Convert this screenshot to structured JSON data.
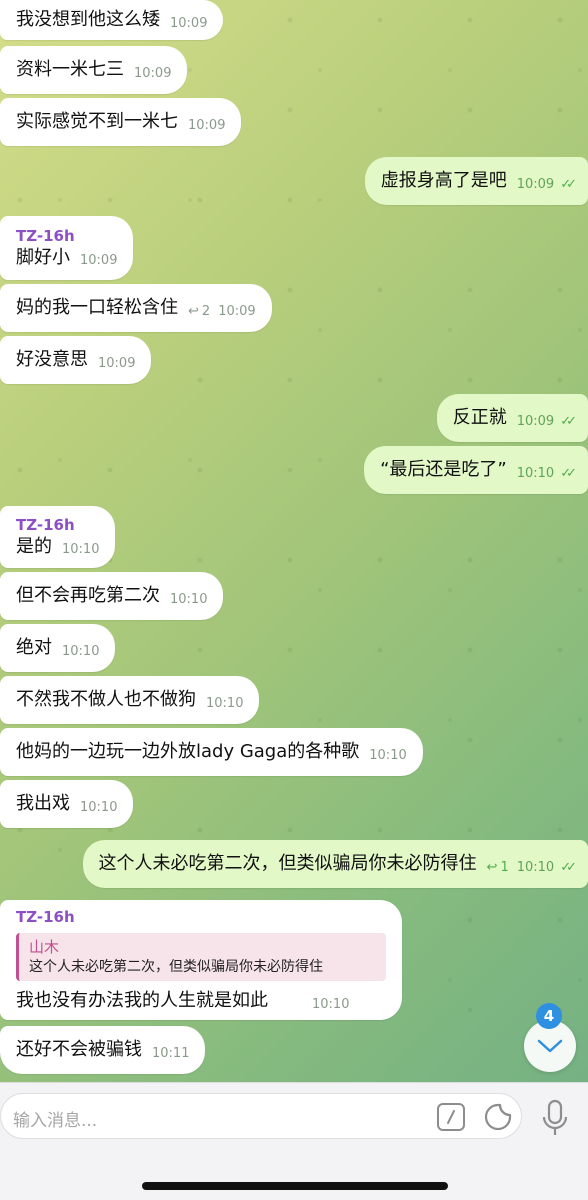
{
  "messages": [
    {
      "text": "我没想到他这么矮",
      "time": "10:09"
    },
    {
      "text": "资料一米七三",
      "time": "10:09"
    },
    {
      "text": "实际感觉不到一米七",
      "time": "10:09"
    },
    {
      "text": "虚报身高了是吧",
      "time": "10:09"
    },
    {
      "sender": "TZ-16h",
      "text": "脚好小",
      "time": "10:09"
    },
    {
      "text": "妈的我一口轻松含住",
      "time": "10:09",
      "reply_count": "2"
    },
    {
      "text": "好没意思",
      "time": "10:09"
    },
    {
      "text": "反正就",
      "time": "10:09"
    },
    {
      "text": "“最后还是吃了”",
      "time": "10:10"
    },
    {
      "sender": "TZ-16h",
      "text": "是的",
      "time": "10:10"
    },
    {
      "text": "但不会再吃第二次",
      "time": "10:10"
    },
    {
      "text": "绝对",
      "time": "10:10"
    },
    {
      "text": "不然我不做人也不做狗",
      "time": "10:10"
    },
    {
      "text": "他妈的一边玩一边外放lady Gaga的各种歌",
      "time": "10:10"
    },
    {
      "text": "我出戏",
      "time": "10:10"
    },
    {
      "text": "这个人未必吃第二次，但类似骗局你未必防得住",
      "time": "10:10",
      "reply_count": "1"
    },
    {
      "sender": "TZ-16h",
      "quote_name": "山木",
      "quote_text": "这个人未必吃第二次，但类似骗局你未必防得住",
      "text": "我也没有办法我的人生就是如此",
      "time": "10:10"
    },
    {
      "text": "还好不会被骗钱",
      "time": "10:11"
    }
  ],
  "scroll_badge": "4",
  "composer": {
    "placeholder": "输入消息..."
  },
  "colors": {
    "outgoing_bubble": "#e3f8c7",
    "incoming_bubble": "#ffffff",
    "sender_name": "#8c4fc4",
    "read_tick": "#4fae4e",
    "badge": "#2f8fe0"
  }
}
